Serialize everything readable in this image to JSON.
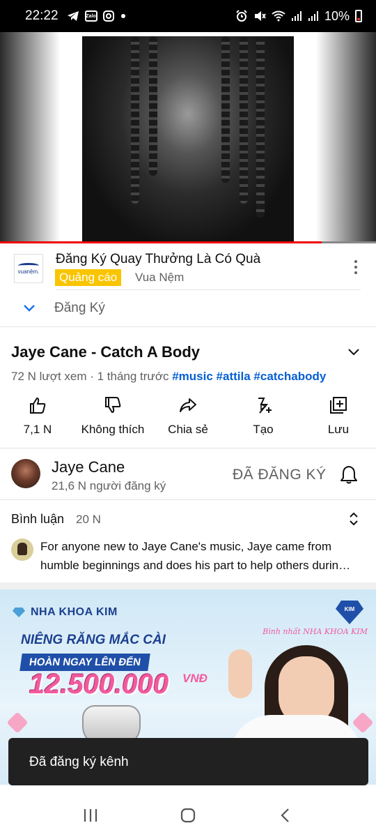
{
  "status_bar": {
    "time": "22:22",
    "notification_icons": [
      "telegram-icon",
      "zalo-icon",
      "instagram-icon",
      "dot-icon"
    ],
    "zalo_label": "Zalo",
    "status_icons": [
      "alarm-icon",
      "mute-icon",
      "wifi-icon",
      "signal-icon",
      "signal-icon"
    ],
    "battery": "10%",
    "battery_color": "#e53935"
  },
  "video": {
    "progress_fraction": 0.855,
    "progress_color": "#ee0000"
  },
  "ad": {
    "advertiser_logo_text": "vuanệm.",
    "title": "Đăng Ký Quay Thưởng Là Có Quà",
    "badge": "Quảng cáo",
    "badge_color": "#f9c400",
    "advertiser": "Vua Nệm",
    "cta": "Đăng Ký"
  },
  "video_info": {
    "title": "Jaye Cane - Catch A Body",
    "meta": "72 N lượt xem · 1 tháng trước",
    "tags": [
      "#music",
      "#attila",
      "#catchabody"
    ],
    "tag_color": "#065fd4"
  },
  "actions": [
    {
      "icon": "like-icon",
      "label": "7,1 N"
    },
    {
      "icon": "dislike-icon",
      "label": "Không thích"
    },
    {
      "icon": "share-icon",
      "label": "Chia sẻ"
    },
    {
      "icon": "create-icon",
      "label": "Tạo"
    },
    {
      "icon": "save-icon",
      "label": "Lưu"
    }
  ],
  "channel": {
    "name": "Jaye Cane",
    "subscribers": "21,6 N người đăng ký",
    "subscribed_label": "ĐÃ ĐĂNG KÝ"
  },
  "comments": {
    "label": "Bình luận",
    "count": "20 N",
    "top_comment_line1": "For anyone new to Jaye Cane's music, Jaye came from",
    "top_comment_line2": "humble beginnings and does his part to help others durin…"
  },
  "banner_ad": {
    "brand": "NHA KHOA KIM",
    "kim_badge": "KIM",
    "script_text": "Bình nhất NHA KHOA KIM",
    "headline": "NIÊNG RĂNG MẮC CÀI",
    "pill": "HOÀN NGAY LÊN ĐẾN",
    "price": "12.500.000",
    "unit": "VNĐ",
    "accent_color": "#f25a9e",
    "brand_color": "#1b3f8f"
  },
  "toast": {
    "message": "Đã đăng ký kênh"
  },
  "navbar": {
    "items": [
      "recent-apps-icon",
      "home-icon",
      "back-icon"
    ]
  }
}
